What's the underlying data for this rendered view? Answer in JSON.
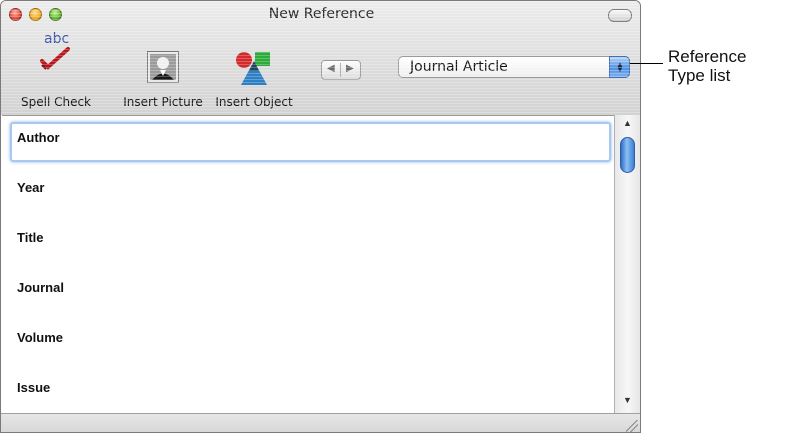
{
  "window": {
    "title": "New Reference"
  },
  "toolbar": {
    "spell_check_label": "Spell Check",
    "spell_check_icon_text": "abc",
    "insert_picture_label": "Insert Picture",
    "insert_object_label": "Insert Object",
    "nav_prev": "◀",
    "nav_next": "▶"
  },
  "reference_type": {
    "selected": "Journal Article"
  },
  "fields": [
    {
      "label": "Author"
    },
    {
      "label": "Year"
    },
    {
      "label": "Title"
    },
    {
      "label": "Journal"
    },
    {
      "label": "Volume"
    },
    {
      "label": "Issue"
    }
  ],
  "scrollbar": {
    "up_arrow": "▲",
    "down_arrow": "▼"
  },
  "callout": {
    "line1": "Reference",
    "line2": "Type list"
  },
  "colors": {
    "focus_ring": "#a8c8ef",
    "select_button": "#4f8fe0",
    "scroll_thumb": "#3d7fd4"
  }
}
